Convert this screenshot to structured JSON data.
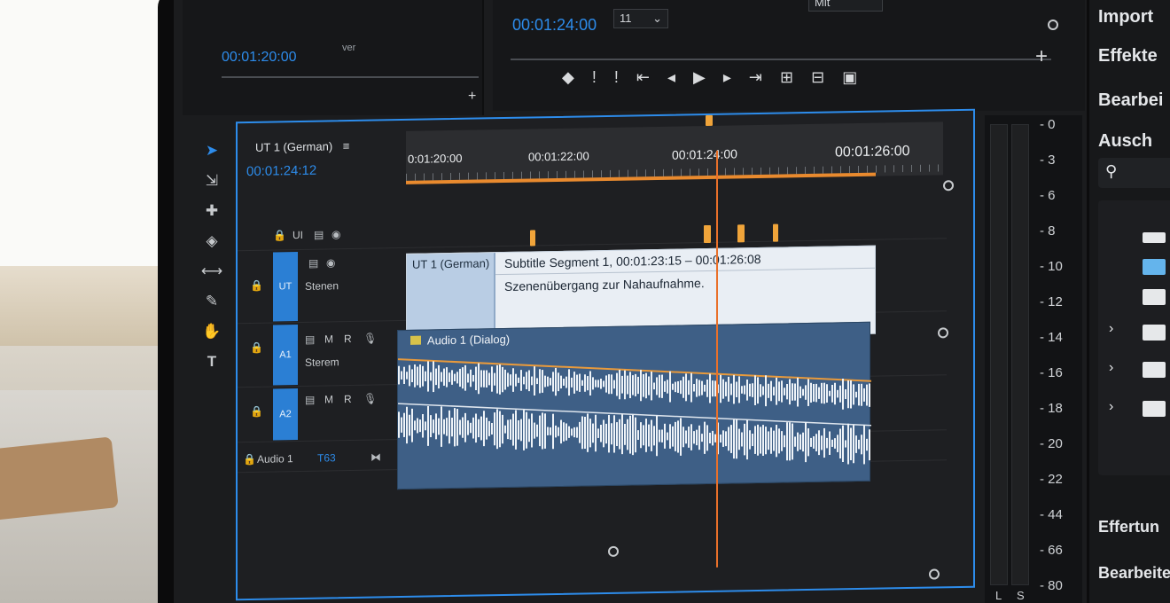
{
  "source_monitor": {
    "timecode": "00:01:20:00",
    "label": "ver"
  },
  "program_monitor": {
    "timecode": "00:01:24:00",
    "fit_dropdown": "11",
    "top_dropdown": "Mit"
  },
  "right_panel": {
    "items": [
      "Import",
      "Effekte",
      "Bearbei",
      "Ausch"
    ],
    "bottom_items": [
      "Effertun",
      "Bearbeite"
    ]
  },
  "level_meter": {
    "labels": [
      "0",
      "3",
      "6",
      "8",
      "10",
      "12",
      "14",
      "16",
      "18",
      "20",
      "22",
      "44",
      "66",
      "80"
    ],
    "channel_labels": [
      "L",
      "S"
    ]
  },
  "timeline": {
    "sequence_title": "UT 1 (German)",
    "timecode": "00:01:24:12",
    "ruler_labels": [
      "0:01:20:00",
      "00:01:22:00",
      "00:01:24:00",
      "00:01:26:00"
    ],
    "tracks": {
      "subtitle_top_label": "UI",
      "subtitle_track_label": "UT",
      "subtitle_track_name": "Stenen",
      "audio1_target": "A1",
      "audio1_name": "Sterem",
      "audio2_target": "A2",
      "audio_master_name": "Audio 1",
      "audio_master_value": "T63",
      "toggles": {
        "mute": "M",
        "record": "R"
      }
    },
    "subtitle_clip": {
      "name": "UT 1 (German)",
      "segment": "Subtitle Segment 1, 00:01:23:15 – 00:01:26:08",
      "text": "Szenenübergang zur Nahaufnahme."
    },
    "audio_clip": {
      "name": "Audio 1 (Dialog)"
    }
  },
  "colors": {
    "accent_blue": "#2d8ceb",
    "playhead_orange": "#e9702a",
    "marker_orange": "#f0a43a",
    "audio_clip": "#3e5f86",
    "subtitle_clip": "#e9eef4"
  },
  "icons": {
    "tools": [
      "selection-arrow",
      "track-select-forward",
      "ripple-edit",
      "razor",
      "slip",
      "pen",
      "hand",
      "type"
    ],
    "transport": [
      "marker",
      "mark-in",
      "mark-out",
      "go-to-in",
      "step-back",
      "play",
      "step-forward",
      "go-to-out",
      "insert",
      "overwrite",
      "export-frame"
    ]
  }
}
